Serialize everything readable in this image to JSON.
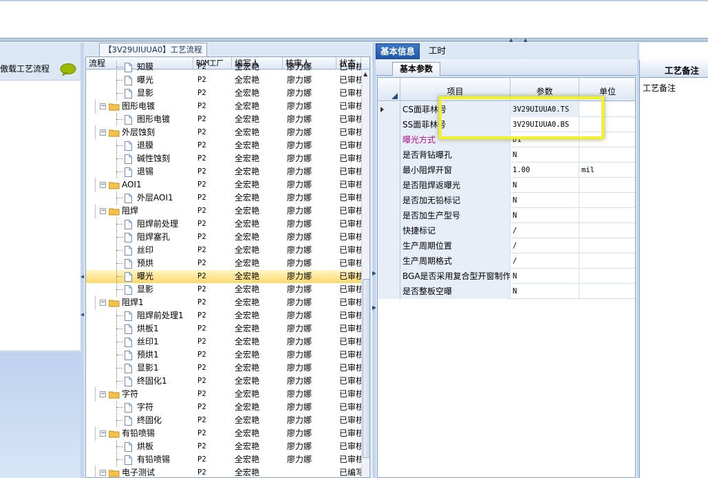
{
  "left_panel": {
    "caption": "傲载工艺流程",
    "icon": "speech-bubble-icon",
    "accent": "#9cb800"
  },
  "tree_panel": {
    "tab_label": "【3V29UIUUA0】工艺流程",
    "columns": [
      "流程",
      "BOM工厂",
      "编写人",
      "核审人",
      "状态"
    ],
    "rows": [
      {
        "name": "知膜",
        "level": 2,
        "type": "doc",
        "bom": "P2",
        "writer": "全宏艳",
        "reviewer": "廖力娜",
        "status": "已审核"
      },
      {
        "name": "曝光",
        "level": 2,
        "type": "doc",
        "bom": "P2",
        "writer": "全宏艳",
        "reviewer": "廖力娜",
        "status": "已审核"
      },
      {
        "name": "显影",
        "level": 2,
        "type": "doc",
        "bom": "P2",
        "writer": "全宏艳",
        "reviewer": "廖力娜",
        "status": "已审核"
      },
      {
        "name": "图形电镀",
        "level": 1,
        "type": "folder",
        "bom": "P2",
        "writer": "全宏艳",
        "reviewer": "廖力娜",
        "status": "已审核"
      },
      {
        "name": "图形电镀",
        "level": 2,
        "type": "doc",
        "bom": "P2",
        "writer": "全宏艳",
        "reviewer": "廖力娜",
        "status": "已审核"
      },
      {
        "name": "外层蚀刻",
        "level": 1,
        "type": "folder",
        "bom": "P2",
        "writer": "全宏艳",
        "reviewer": "廖力娜",
        "status": "已审核"
      },
      {
        "name": "退膜",
        "level": 2,
        "type": "doc",
        "bom": "P2",
        "writer": "全宏艳",
        "reviewer": "廖力娜",
        "status": "已审核"
      },
      {
        "name": "碱性蚀刻",
        "level": 2,
        "type": "doc",
        "bom": "P2",
        "writer": "全宏艳",
        "reviewer": "廖力娜",
        "status": "已审核"
      },
      {
        "name": "退锡",
        "level": 2,
        "type": "doc",
        "bom": "P2",
        "writer": "全宏艳",
        "reviewer": "廖力娜",
        "status": "已审核"
      },
      {
        "name": "AOI1",
        "level": 1,
        "type": "folder",
        "bom": "P2",
        "writer": "全宏艳",
        "reviewer": "廖力娜",
        "status": "已审核"
      },
      {
        "name": "外层AOI1",
        "level": 2,
        "type": "doc",
        "bom": "P2",
        "writer": "全宏艳",
        "reviewer": "廖力娜",
        "status": "已审核"
      },
      {
        "name": "阻焊",
        "level": 1,
        "type": "folder",
        "bom": "P2",
        "writer": "全宏艳",
        "reviewer": "廖力娜",
        "status": "已审核"
      },
      {
        "name": "阻焊前处理",
        "level": 2,
        "type": "doc",
        "bom": "P2",
        "writer": "全宏艳",
        "reviewer": "廖力娜",
        "status": "已审核"
      },
      {
        "name": "阻焊塞孔",
        "level": 2,
        "type": "doc",
        "bom": "P2",
        "writer": "全宏艳",
        "reviewer": "廖力娜",
        "status": "已审核"
      },
      {
        "name": "丝印",
        "level": 2,
        "type": "doc",
        "bom": "P2",
        "writer": "全宏艳",
        "reviewer": "廖力娜",
        "status": "已审核"
      },
      {
        "name": "预烘",
        "level": 2,
        "type": "doc",
        "bom": "P2",
        "writer": "全宏艳",
        "reviewer": "廖力娜",
        "status": "已审核"
      },
      {
        "name": "曝光",
        "level": 2,
        "type": "doc",
        "bom": "P2",
        "writer": "全宏艳",
        "reviewer": "廖力娜",
        "status": "已审核",
        "selected": true
      },
      {
        "name": "显影",
        "level": 2,
        "type": "doc",
        "bom": "P2",
        "writer": "全宏艳",
        "reviewer": "廖力娜",
        "status": "已审核"
      },
      {
        "name": "阻焊1",
        "level": 1,
        "type": "folder",
        "bom": "P2",
        "writer": "全宏艳",
        "reviewer": "廖力娜",
        "status": "已审核"
      },
      {
        "name": "阻焊前处理1",
        "level": 2,
        "type": "doc",
        "bom": "P2",
        "writer": "全宏艳",
        "reviewer": "廖力娜",
        "status": "已审核"
      },
      {
        "name": "烘板1",
        "level": 2,
        "type": "doc",
        "bom": "P2",
        "writer": "全宏艳",
        "reviewer": "廖力娜",
        "status": "已审核"
      },
      {
        "name": "丝印1",
        "level": 2,
        "type": "doc",
        "bom": "P2",
        "writer": "全宏艳",
        "reviewer": "廖力娜",
        "status": "已审核"
      },
      {
        "name": "预烘1",
        "level": 2,
        "type": "doc",
        "bom": "P2",
        "writer": "全宏艳",
        "reviewer": "廖力娜",
        "status": "已审核"
      },
      {
        "name": "显影1",
        "level": 2,
        "type": "doc",
        "bom": "P2",
        "writer": "全宏艳",
        "reviewer": "廖力娜",
        "status": "已审核"
      },
      {
        "name": "终固化1",
        "level": 2,
        "type": "doc",
        "bom": "P2",
        "writer": "全宏艳",
        "reviewer": "廖力娜",
        "status": "已审核"
      },
      {
        "name": "字符",
        "level": 1,
        "type": "folder",
        "bom": "P2",
        "writer": "全宏艳",
        "reviewer": "廖力娜",
        "status": "已审核"
      },
      {
        "name": "字符",
        "level": 2,
        "type": "doc",
        "bom": "P2",
        "writer": "全宏艳",
        "reviewer": "廖力娜",
        "status": "已审核"
      },
      {
        "name": "终固化",
        "level": 2,
        "type": "doc",
        "bom": "P2",
        "writer": "全宏艳",
        "reviewer": "廖力娜",
        "status": "已审核"
      },
      {
        "name": "有铅喷锡",
        "level": 1,
        "type": "folder",
        "bom": "P2",
        "writer": "全宏艳",
        "reviewer": "廖力娜",
        "status": "已审核"
      },
      {
        "name": "烘板",
        "level": 2,
        "type": "doc",
        "bom": "P2",
        "writer": "全宏艳",
        "reviewer": "廖力娜",
        "status": "已审核"
      },
      {
        "name": "有铅喷锡",
        "level": 2,
        "type": "doc",
        "bom": "P2",
        "writer": "全宏艳",
        "reviewer": "廖力娜",
        "status": "已审核"
      },
      {
        "name": "电子测试",
        "level": 1,
        "type": "folder",
        "bom": "P2",
        "writer": "全宏艳",
        "reviewer": "",
        "status": "已编写"
      }
    ]
  },
  "right_panel": {
    "tabs": [
      "基本信息",
      "工时"
    ],
    "subtab": "基本参数",
    "columns": [
      "项目",
      "参数",
      "单位"
    ],
    "rows": [
      {
        "item": "CS面菲林号",
        "value": "3V29UIUUA0.TS",
        "unit": "",
        "current": true
      },
      {
        "item": "SS面菲林号",
        "value": "3V29UIUUA0.BS",
        "unit": ""
      },
      {
        "item": "曝光方式",
        "value": "D1",
        "unit": "",
        "highlight": true
      },
      {
        "item": "是否背钻曝孔",
        "value": "N",
        "unit": ""
      },
      {
        "item": "最小阻焊开窗",
        "value": "1.00",
        "unit": "mil"
      },
      {
        "item": "是否阻焊返曝光",
        "value": "N",
        "unit": ""
      },
      {
        "item": "是否加无铅标记",
        "value": "N",
        "unit": ""
      },
      {
        "item": "是否加生产型号",
        "value": "N",
        "unit": ""
      },
      {
        "item": "快捷标记",
        "value": "/",
        "unit": ""
      },
      {
        "item": "生产周期位置",
        "value": "/",
        "unit": ""
      },
      {
        "item": "生产周期格式",
        "value": "/",
        "unit": ""
      },
      {
        "item": "BGA是否采用复合型开窗制作",
        "value": "N",
        "unit": ""
      },
      {
        "item": "是否整板空曝",
        "value": "N",
        "unit": ""
      }
    ]
  },
  "far_right": {
    "header": "工艺备注",
    "caption": "工艺备注"
  },
  "colors": {
    "selection": "#ffd96a",
    "highlight_box": "#f2f22a",
    "magenta_label": "#b0108a",
    "tab_active": "#1f58a9"
  }
}
